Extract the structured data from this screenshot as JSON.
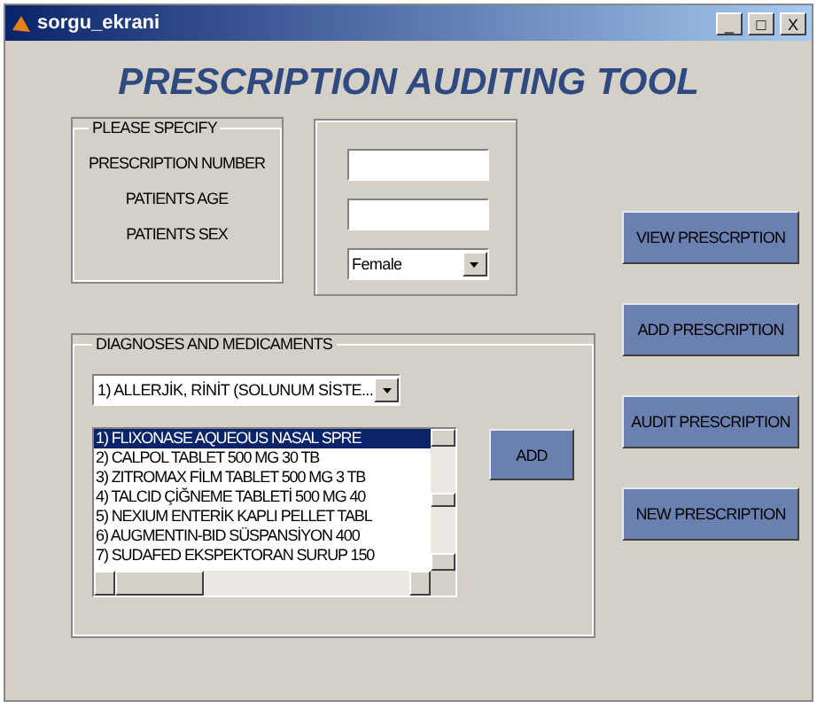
{
  "window": {
    "title": "sorgu_ekrani",
    "controls": [
      "_",
      "□",
      "X"
    ]
  },
  "heading": "PRESCRIPTION AUDITING TOOL",
  "specify_panel": {
    "title": "PLEASE SPECIFY",
    "labels": [
      "PRESCRIPTION NUMBER",
      "PATIENTS AGE",
      "PATIENTS SEX"
    ]
  },
  "inputs": {
    "patients_sex": {
      "value": "Female"
    }
  },
  "diagnoses_panel": {
    "title": "DIAGNOSES AND MEDICAMENTS",
    "diagnosis": "1) ALLERJİK, RİNİT (SOLUNUM SİSTE...",
    "medicaments": [
      {
        "label": "1) FLIXONASE AQUEOUS NASAL SPRE",
        "selected": true
      },
      {
        "label": "2) CALPOL TABLET 500 MG 30 TB",
        "selected": false
      },
      {
        "label": "3) ZITROMAX FİLM TABLET 500 MG 3 TB",
        "selected": false
      },
      {
        "label": "4) TALCID ÇİĞNEME TABLETİ 500 MG 40",
        "selected": false
      },
      {
        "label": "5) NEXIUM ENTERİK KAPLI PELLET TABL",
        "selected": false
      },
      {
        "label": "6) AUGMENTIN-BID SÜSPANSİYON 400",
        "selected": false
      },
      {
        "label": "7) SUDAFED EKSPEKTORAN SURUP 150",
        "selected": false
      }
    ],
    "add_button": "ADD"
  },
  "buttons": [
    "VIEW PRESCRPTION",
    "ADD PRESCRIPTION",
    "AUDIT PRESCRIPTION",
    "NEW PRESCRIPTION"
  ]
}
